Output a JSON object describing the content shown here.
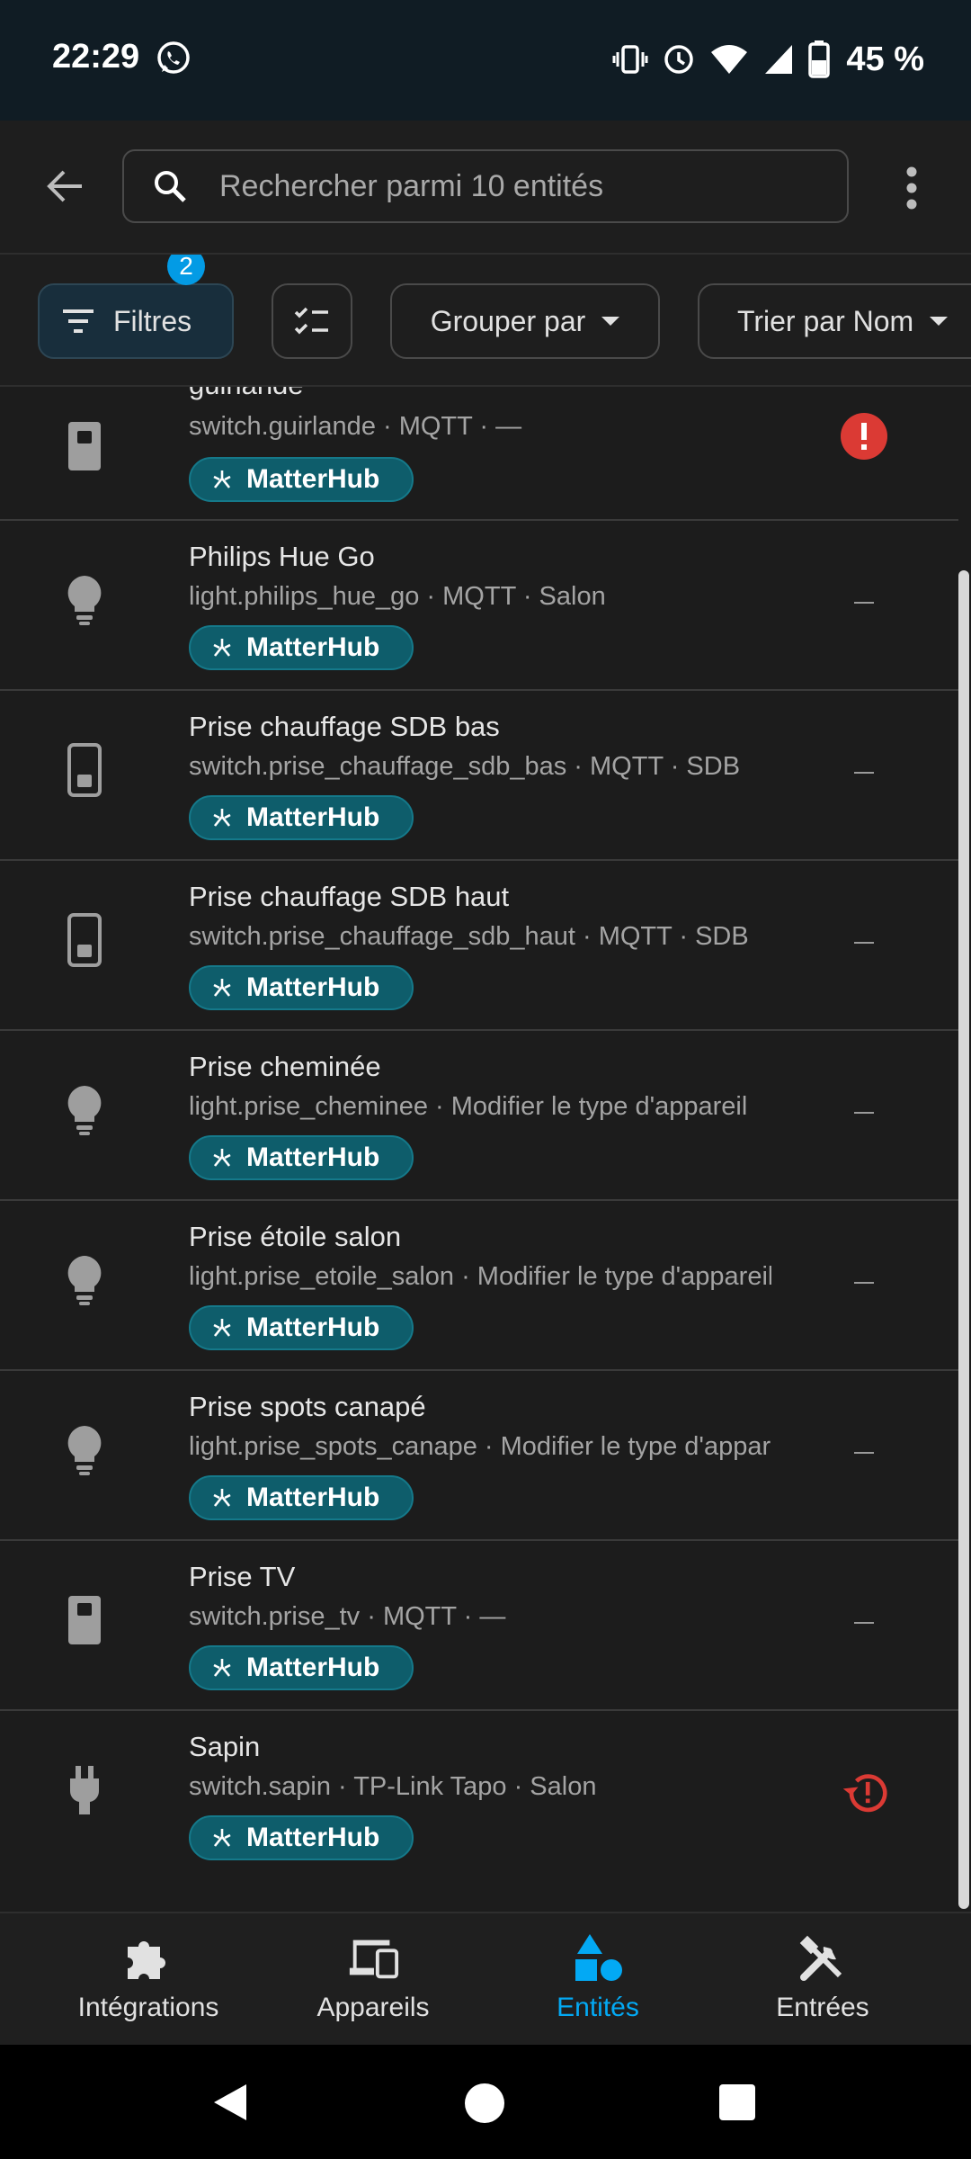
{
  "status_bar": {
    "time": "22:29",
    "battery_percent": "45 %",
    "icons": [
      "whatsapp-icon",
      "vibrate-icon",
      "alarm-icon",
      "wifi-icon",
      "signal-icon",
      "battery-icon"
    ]
  },
  "search": {
    "placeholder": "Rechercher parmi 10 entités"
  },
  "filters": {
    "filters_label": "Filtres",
    "filters_count": "2",
    "group_label": "Grouper par",
    "sort_label": "Trier par Nom"
  },
  "entities": [
    {
      "name": "guirlande",
      "subtitle": "switch.guirlande · MQTT · —",
      "badge": "MatterHub",
      "icon": "switch-icon",
      "status": "error"
    },
    {
      "name": "Philips Hue Go",
      "subtitle": "light.philips_hue_go · MQTT · Salon",
      "badge": "MatterHub",
      "icon": "lightbulb-icon",
      "status": "none"
    },
    {
      "name": "Prise chauffage SDB bas",
      "subtitle": "switch.prise_chauffage_sdb_bas · MQTT · SDB",
      "badge": "MatterHub",
      "icon": "switch-off-icon",
      "status": "none"
    },
    {
      "name": "Prise chauffage SDB haut",
      "subtitle": "switch.prise_chauffage_sdb_haut · MQTT · SDB",
      "badge": "MatterHub",
      "icon": "switch-off-icon",
      "status": "none"
    },
    {
      "name": "Prise cheminée",
      "subtitle": "light.prise_cheminee · Modifier le type d'appareil",
      "badge": "MatterHub",
      "icon": "lightbulb-icon",
      "status": "none"
    },
    {
      "name": "Prise étoile salon",
      "subtitle": "light.prise_etoile_salon · Modifier le type d'appareil",
      "badge": "MatterHub",
      "icon": "lightbulb-icon",
      "status": "none"
    },
    {
      "name": "Prise spots canapé",
      "subtitle": "light.prise_spots_canape · Modifier le type d'appareil",
      "badge": "MatterHub",
      "icon": "lightbulb-icon",
      "status": "none"
    },
    {
      "name": "Prise TV",
      "subtitle": "switch.prise_tv · MQTT · —",
      "badge": "MatterHub",
      "icon": "switch-icon",
      "status": "none"
    },
    {
      "name": "Sapin",
      "subtitle": "switch.sapin · TP-Link Tapo · Salon",
      "badge": "MatterHub",
      "icon": "plug-icon",
      "status": "restore"
    }
  ],
  "bottom_nav": [
    {
      "label": "Intégrations",
      "icon": "puzzle-icon",
      "active": false
    },
    {
      "label": "Appareils",
      "icon": "devices-icon",
      "active": false
    },
    {
      "label": "Entités",
      "icon": "shapes-icon",
      "active": true
    },
    {
      "label": "Entrées",
      "icon": "tools-icon",
      "active": false
    }
  ],
  "colors": {
    "accent": "#03a9f4",
    "badge_bg": "#0e5d6b",
    "error": "#e53935",
    "background": "#1c1c1c"
  }
}
